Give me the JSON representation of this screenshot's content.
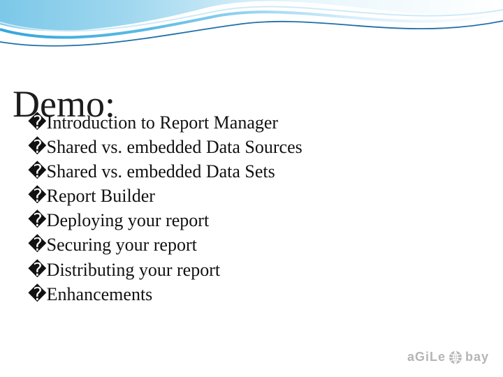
{
  "title": "Demo:",
  "bullets": [
    "Introduction to Report Manager",
    "Shared vs. embedded Data Sources",
    "Shared vs. embedded Data Sets",
    "Report Builder",
    "Deploying your report",
    "Securing your report",
    "Distributing your report",
    "Enhancements"
  ],
  "bullet_glyph": "�",
  "logo": {
    "pre": "aGiLe",
    "post": "bay"
  }
}
